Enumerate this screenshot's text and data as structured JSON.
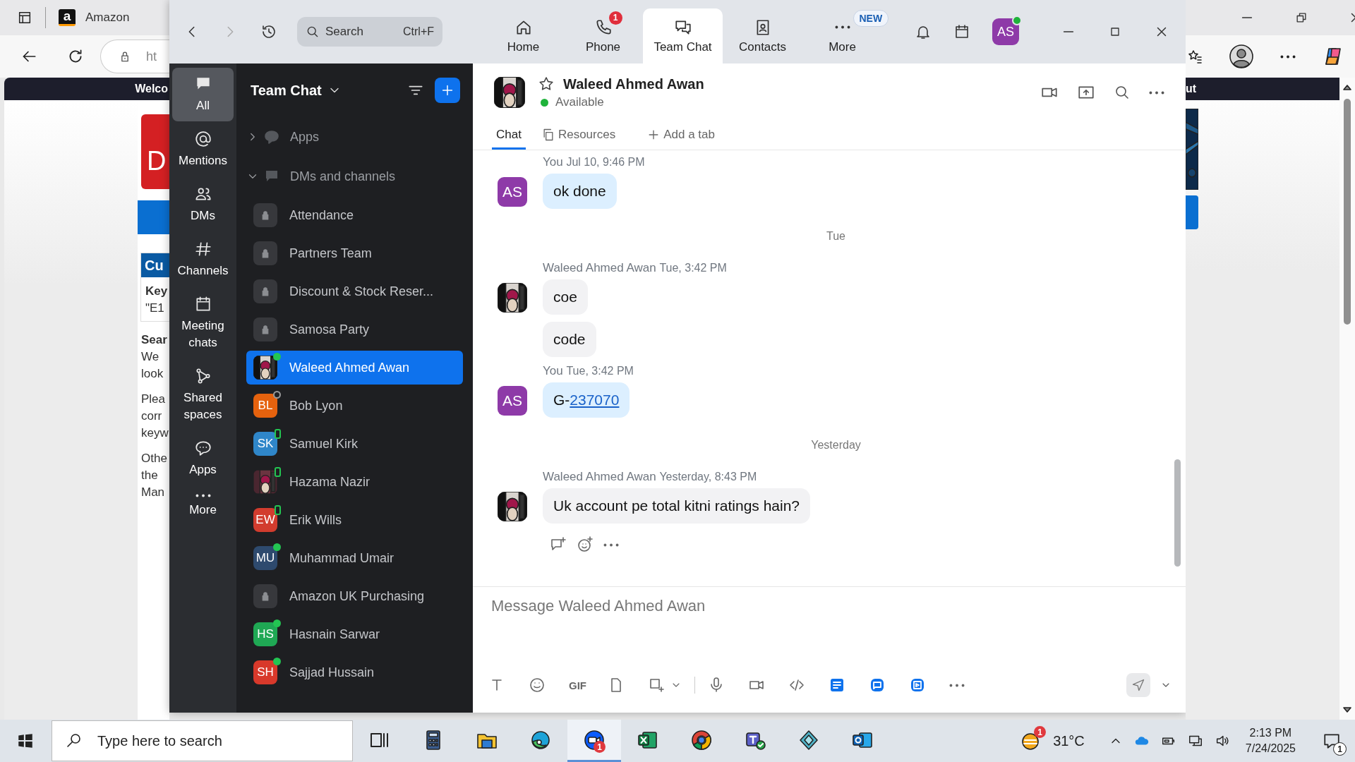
{
  "browser": {
    "tab_title": "Amazon",
    "logo_letter": "a",
    "address": "ht",
    "page": {
      "banner_left": "Welco",
      "banner_right": "ut",
      "logo_text": "D",
      "box_title": "Cu",
      "box_label": "Key",
      "box_value": "\"E1",
      "heading": "Sear",
      "paragraphs": [
        [
          "We",
          "look"
        ],
        [
          "Plea",
          "corr",
          "keyw"
        ],
        [
          "Othe",
          "the",
          "Man"
        ]
      ]
    }
  },
  "zoom": {
    "nav_search": {
      "placeholder": "Search",
      "shortcut": "Ctrl+F"
    },
    "top_tabs": [
      {
        "label": "Home",
        "selected": false
      },
      {
        "label": "Phone",
        "badge": "1",
        "selected": false
      },
      {
        "label": "Team Chat",
        "selected": true
      },
      {
        "label": "Contacts",
        "selected": false
      },
      {
        "label": "More",
        "tag": "NEW",
        "selected": false
      }
    ],
    "profile": {
      "initials": "AS",
      "online": true
    },
    "rail": [
      {
        "label": "All",
        "selected": true
      },
      {
        "label": "Mentions",
        "selected": false
      },
      {
        "label": "DMs",
        "selected": false
      },
      {
        "label": "Channels",
        "selected": false
      },
      {
        "label": "Meeting chats",
        "selected": false
      },
      {
        "label": "Shared spaces",
        "selected": false
      },
      {
        "label": "Apps",
        "selected": false
      },
      {
        "label": "More",
        "selected": false
      }
    ],
    "list_title": "Team Chat",
    "groups": [
      {
        "label": "Apps",
        "expanded": false
      },
      {
        "label": "DMs and channels",
        "expanded": true,
        "children": [
          {
            "kind": "channel",
            "name": "Attendance",
            "selected": false
          },
          {
            "kind": "channel",
            "name": "Partners Team",
            "selected": false
          },
          {
            "kind": "channel",
            "name": "Discount & Stock Reser...",
            "selected": false
          },
          {
            "kind": "channel",
            "name": "Samosa Party",
            "selected": false
          },
          {
            "kind": "contact",
            "name": "Waleed Ahmed Awan",
            "online": true,
            "mobile": false,
            "selected": true
          },
          {
            "kind": "contact",
            "name": "Bob Lyon",
            "initials": "BL",
            "color": "#e5620e",
            "online": false,
            "mobile": false,
            "selected": false
          },
          {
            "kind": "contact",
            "name": "Samuel Kirk",
            "initials": "SK",
            "color": "#2f86c9",
            "online": true,
            "mobile": true,
            "selected": false
          },
          {
            "kind": "contact",
            "name": "Hazama Nazir",
            "online": true,
            "mobile": true,
            "selected": false
          },
          {
            "kind": "contact",
            "name": "Erik Wills",
            "initials": "EW",
            "color": "#d23c2e",
            "online": true,
            "mobile": true,
            "selected": false
          },
          {
            "kind": "contact",
            "name": "Muhammad Umair",
            "initials": "MU",
            "color": "#2e4a6e",
            "online": true,
            "mobile": false,
            "selected": false
          },
          {
            "kind": "channel",
            "name": "Amazon UK Purchasing",
            "selected": false
          },
          {
            "kind": "contact",
            "name": "Hasnain Sarwar",
            "initials": "HS",
            "color": "#1fa854",
            "online": true,
            "mobile": false,
            "selected": false
          },
          {
            "kind": "contact",
            "name": "Sajjad Hussain",
            "initials": "SH",
            "color": "#d8392b",
            "online": true,
            "mobile": false,
            "selected": false
          }
        ]
      }
    ],
    "chat": {
      "title": "Waleed Ahmed Awan",
      "starred": false,
      "presence": "Available",
      "online": true,
      "tabs": [
        {
          "label": "Chat",
          "kind": "chat",
          "selected": true
        },
        {
          "label": "Resources",
          "kind": "resources",
          "selected": false
        }
      ],
      "add_tab": "Add a tab",
      "timeline": [
        {
          "kind": "message",
          "sender": "You",
          "time": "Jul 10, 9:46 PM",
          "mine": true,
          "avatar_initials": "AS",
          "bubbles": [
            {
              "text": "ok done"
            }
          ]
        },
        {
          "kind": "divider",
          "label": "Tue"
        },
        {
          "kind": "message",
          "sender": "Waleed Ahmed Awan",
          "time": "Tue, 3:42 PM",
          "mine": false,
          "bubbles": [
            {
              "text": "coe"
            },
            {
              "text": "code"
            }
          ]
        },
        {
          "kind": "message",
          "sender": "You",
          "time": "Tue, 3:42 PM",
          "mine": true,
          "avatar_initials": "AS",
          "bubbles": [
            {
              "text": "G-",
              "link": "237070"
            }
          ]
        },
        {
          "kind": "divider",
          "label": "Yesterday"
        },
        {
          "kind": "message",
          "sender": "Waleed Ahmed Awan",
          "time": "Yesterday, 8:43 PM",
          "mine": false,
          "hovered": true,
          "bubbles": [
            {
              "text": "Uk account pe total kitni ratings hain?"
            }
          ]
        }
      ]
    },
    "composer": {
      "placeholder": "Message Waleed Ahmed Awan",
      "gif": "GIF"
    }
  },
  "taskbar": {
    "search_placeholder": "Type here to search",
    "apps": [
      {
        "kind": "taskview",
        "active": false
      },
      {
        "kind": "calculator",
        "active": false
      },
      {
        "kind": "explorer",
        "active": false
      },
      {
        "kind": "edge",
        "active": false
      },
      {
        "kind": "zoom",
        "active": true,
        "badge": "1"
      },
      {
        "kind": "excel",
        "active": false
      },
      {
        "kind": "chrome",
        "active": false
      },
      {
        "kind": "teams",
        "active": false
      },
      {
        "kind": "gem",
        "active": false
      },
      {
        "kind": "outlook",
        "active": false
      }
    ],
    "weather": {
      "temp": "31°C",
      "badge": "1"
    },
    "time": "2:13 PM",
    "date": "7/24/2025",
    "notifications": "1"
  }
}
